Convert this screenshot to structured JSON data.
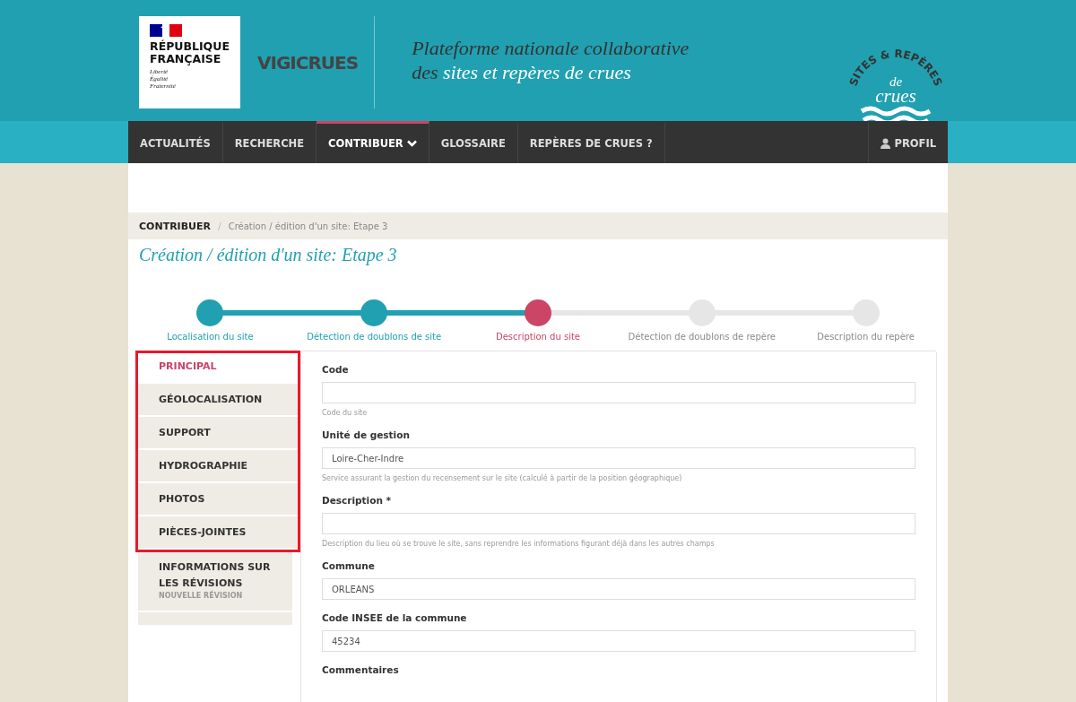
{
  "header": {
    "gov_logo": {
      "name": "RÉPUBLIQUE FRANÇAISE",
      "motto": [
        "Liberté",
        "Égalité",
        "Fraternité"
      ]
    },
    "brand": "VIGICRUES",
    "tagline_plain_1": "Plateforme nationale collaborative",
    "tagline_plain_2": "des ",
    "tagline_emphasis": "sites et repères de crues",
    "badge": {
      "arc": "SITES & REPÈRES",
      "small": "de",
      "big": "crues"
    }
  },
  "nav": {
    "items": [
      {
        "label": "ACTUALITÉS",
        "selected": false,
        "dropdown": false
      },
      {
        "label": "RECHERCHE",
        "selected": false,
        "dropdown": false
      },
      {
        "label": "CONTRIBUER",
        "selected": true,
        "dropdown": true
      },
      {
        "label": "GLOSSAIRE",
        "selected": false,
        "dropdown": false
      },
      {
        "label": "REPÈRES DE CRUES ?",
        "selected": false,
        "dropdown": false
      }
    ],
    "profile": "PROFIL"
  },
  "breadcrumb": {
    "root": "CONTRIBUER",
    "separator": "/",
    "current": "Création / édition d'un site: Etape 3"
  },
  "page_title": "Création / édition d'un site: Etape 3",
  "steps": [
    {
      "label": "Localisation du site",
      "done": true,
      "current": false
    },
    {
      "label": "Détection de doublons de site",
      "done": true,
      "current": false
    },
    {
      "label": "Description du site",
      "done": false,
      "current": true
    },
    {
      "label": "Détection de doublons de repère",
      "done": false,
      "current": false
    },
    {
      "label": "Description du repère",
      "done": false,
      "current": false
    }
  ],
  "sidebar": {
    "items": [
      {
        "label": "PRINCIPAL",
        "selected": true,
        "highlighted": true
      },
      {
        "label": "GÉOLOCALISATION",
        "selected": false,
        "highlighted": true
      },
      {
        "label": "SUPPORT",
        "selected": false,
        "highlighted": true
      },
      {
        "label": "HYDROGRAPHIE",
        "selected": false,
        "highlighted": true
      },
      {
        "label": "PHOTOS",
        "selected": false,
        "highlighted": true
      },
      {
        "label": "PIÈCES-JOINTES",
        "selected": false,
        "highlighted": true
      },
      {
        "label": "INFORMATIONS SUR LES RÉVISIONS",
        "sublabel": "NOUVELLE RÉVISION",
        "selected": false,
        "highlighted": false
      }
    ]
  },
  "form": {
    "fields": [
      {
        "label": "Code",
        "kind": "input",
        "help": "Code du site"
      },
      {
        "label": "Unité de gestion",
        "kind": "input",
        "value": "Loire-Cher-Indre",
        "help": "Service assurant la gestion du recensement sur le site (calculé à partir de la position géographique)"
      },
      {
        "label": "Description *",
        "kind": "input",
        "help": "Description du lieu où se trouve le site, sans reprendre les informations figurant déjà dans les autres champs"
      },
      {
        "label": "Commune",
        "kind": "input",
        "value": "ORLEANS"
      },
      {
        "label": "Code INSEE de la commune",
        "kind": "input",
        "value": "45234"
      },
      {
        "label": "Commentaires",
        "kind": "label"
      }
    ]
  }
}
